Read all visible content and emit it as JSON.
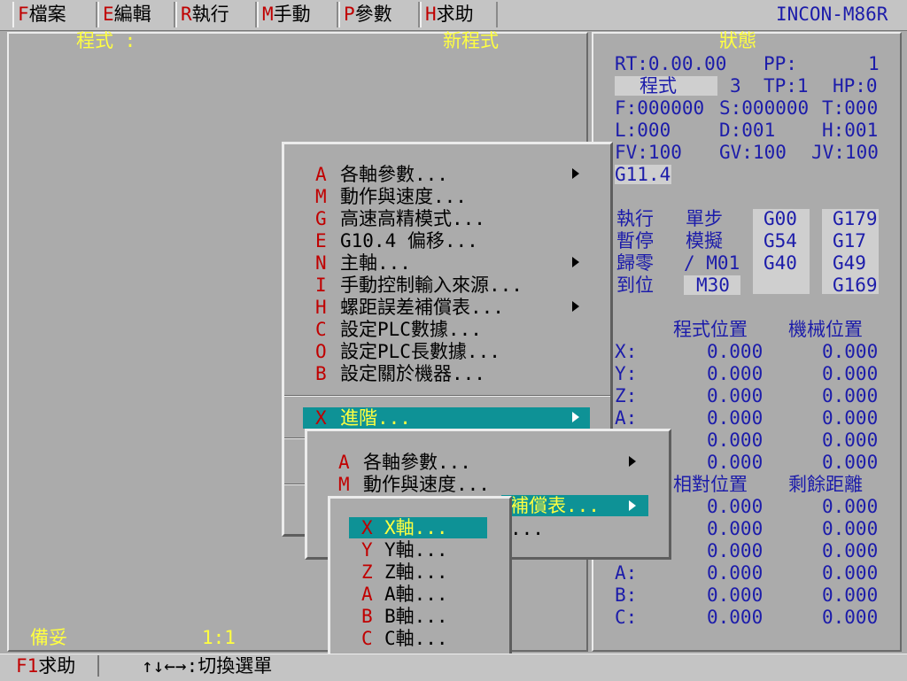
{
  "menubar": {
    "items": [
      {
        "hot": "F",
        "label": "檔案"
      },
      {
        "hot": "E",
        "label": "編輯"
      },
      {
        "hot": "R",
        "label": "執行"
      },
      {
        "hot": "M",
        "label": "手動"
      },
      {
        "hot": "P",
        "label": "參數"
      },
      {
        "hot": "H",
        "label": "求助"
      }
    ],
    "brand": "INCON-M86R"
  },
  "program_panel": {
    "title": "程式 :",
    "new_program": "新程式",
    "status_ready": "備妥",
    "ratio": "1:1"
  },
  "status_panel": {
    "title": "狀態",
    "rt": "RT:0.00.00",
    "pp": "PP:",
    "pp_value": "1",
    "mode_label": "程式",
    "mode_num": "3",
    "tp": "TP:1",
    "hp": "HP:0",
    "f": "F:000000",
    "s": "S:000000",
    "t": "T:000",
    "l": "L:000",
    "d": "D:001",
    "h": "H:001",
    "fv": "FV:100",
    "gv": "GV:100",
    "jv": "JV:100",
    "g114": "G11.4",
    "grid": [
      [
        "執行",
        "單步",
        "G00",
        "G179"
      ],
      [
        "暫停",
        "模擬",
        "G54",
        "G17"
      ],
      [
        "歸零",
        "/ M01",
        "G40",
        "G49"
      ],
      [
        "到位",
        "M30",
        "",
        "G169"
      ]
    ],
    "hdr_prog_pos": "程式位置",
    "hdr_mach_pos": "機械位置",
    "hdr_rel_pos": "相對位置",
    "hdr_remain": "剩餘距離",
    "axes1": [
      {
        "axis": "X:",
        "prog": "0.000",
        "mach": "0.000"
      },
      {
        "axis": "Y:",
        "prog": "0.000",
        "mach": "0.000"
      },
      {
        "axis": "Z:",
        "prog": "0.000",
        "mach": "0.000"
      },
      {
        "axis": "A:",
        "prog": "0.000",
        "mach": "0.000"
      },
      {
        "axis": "",
        "prog": "0.000",
        "mach": "0.000"
      },
      {
        "axis": "",
        "prog": "0.000",
        "mach": "0.000"
      }
    ],
    "axes2": [
      {
        "axis": "",
        "rel": "0.000",
        "rem": "0.000"
      },
      {
        "axis": "",
        "rel": "0.000",
        "rem": "0.000"
      },
      {
        "axis": "",
        "rel": "0.000",
        "rem": "0.000"
      },
      {
        "axis": "A:",
        "rel": "0.000",
        "rem": "0.000"
      },
      {
        "axis": "B:",
        "rel": "0.000",
        "rem": "0.000"
      },
      {
        "axis": "C:",
        "rel": "0.000",
        "rem": "0.000"
      }
    ]
  },
  "param_menu": {
    "items": [
      {
        "hot": "A",
        "label": "各軸參數...",
        "sub": true
      },
      {
        "hot": "M",
        "label": "動作與速度...",
        "sub": false
      },
      {
        "hot": "G",
        "label": "高速高精模式...",
        "sub": false
      },
      {
        "hot": "E",
        "label": "G10.4 偏移...",
        "sub": false
      },
      {
        "hot": "N",
        "label": "主軸...",
        "sub": true
      },
      {
        "hot": "I",
        "label": "手動控制輸入來源...",
        "sub": false
      },
      {
        "hot": "H",
        "label": "螺距誤差補償表...",
        "sub": true
      },
      {
        "hot": "C",
        "label": "設定PLC數據...",
        "sub": false
      },
      {
        "hot": "O",
        "label": "設定PLC長數據...",
        "sub": false
      },
      {
        "hot": "B",
        "label": "設定關於機器...",
        "sub": false
      }
    ],
    "advanced": {
      "hot": "X",
      "label": "進階..."
    }
  },
  "advanced_menu": {
    "items": [
      {
        "hot": "A",
        "label": "各軸參數..."
      },
      {
        "hot": "M",
        "label": "動作與速度..."
      }
    ],
    "highlight_partial": "補償表...",
    "partial_below": "..."
  },
  "axis_menu": {
    "items": [
      {
        "hot": "X",
        "label": "X軸..."
      },
      {
        "hot": "Y",
        "label": "Y軸..."
      },
      {
        "hot": "Z",
        "label": "Z軸..."
      },
      {
        "hot": "A",
        "label": "A軸..."
      },
      {
        "hot": "B",
        "label": "B軸..."
      },
      {
        "hot": "C",
        "label": "C軸..."
      }
    ]
  },
  "statusbar": {
    "f1_hot": "F1",
    "f1_label": "求助",
    "nav_hint": "↑↓←→:切換選單"
  }
}
